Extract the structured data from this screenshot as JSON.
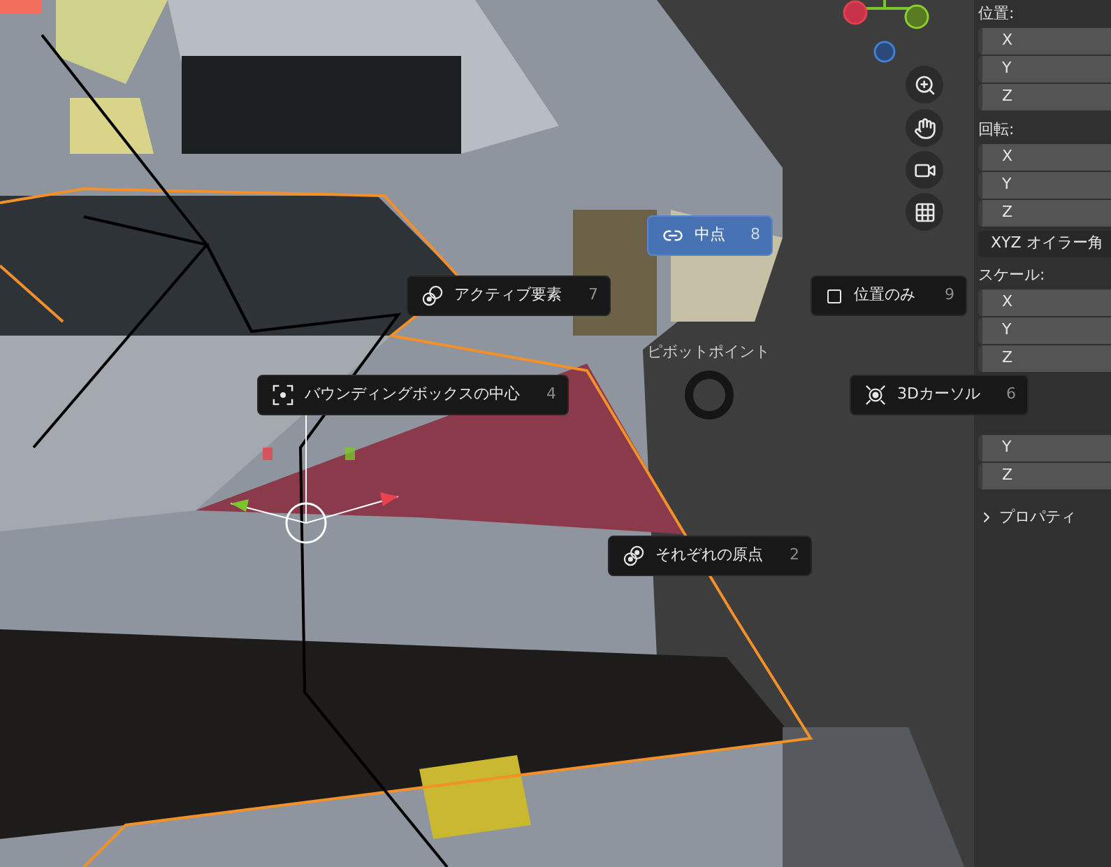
{
  "pie_menu": {
    "title": "ピボットポイント",
    "items": [
      {
        "label": "中点",
        "shortcut": "8",
        "selected": true
      },
      {
        "label": "アクティブ要素",
        "shortcut": "7",
        "selected": false
      },
      {
        "label": "位置のみ",
        "shortcut": "9",
        "selected": false
      },
      {
        "label": "バウンディングボックスの中心",
        "shortcut": "4",
        "selected": false
      },
      {
        "label": "3Dカーソル",
        "shortcut": "6",
        "selected": false
      },
      {
        "label": "それぞれの原点",
        "shortcut": "2",
        "selected": false
      }
    ]
  },
  "sidebar": {
    "groups": [
      {
        "label": "位置:",
        "fields": [
          {
            "axis": "X"
          },
          {
            "axis": "Y"
          },
          {
            "axis": "Z"
          }
        ]
      },
      {
        "label": "回転:",
        "fields": [
          {
            "axis": "X"
          },
          {
            "axis": "Y"
          },
          {
            "axis": "Z"
          }
        ],
        "mode": "XYZ オイラー角"
      },
      {
        "label": "スケール:",
        "fields": [
          {
            "axis": "X"
          },
          {
            "axis": "Y"
          },
          {
            "axis": "Z"
          }
        ]
      },
      {
        "fields": [
          {
            "axis": "Y"
          },
          {
            "axis": "Z"
          }
        ]
      }
    ],
    "panel": {
      "label": "プロパティ",
      "expanded": false
    }
  }
}
